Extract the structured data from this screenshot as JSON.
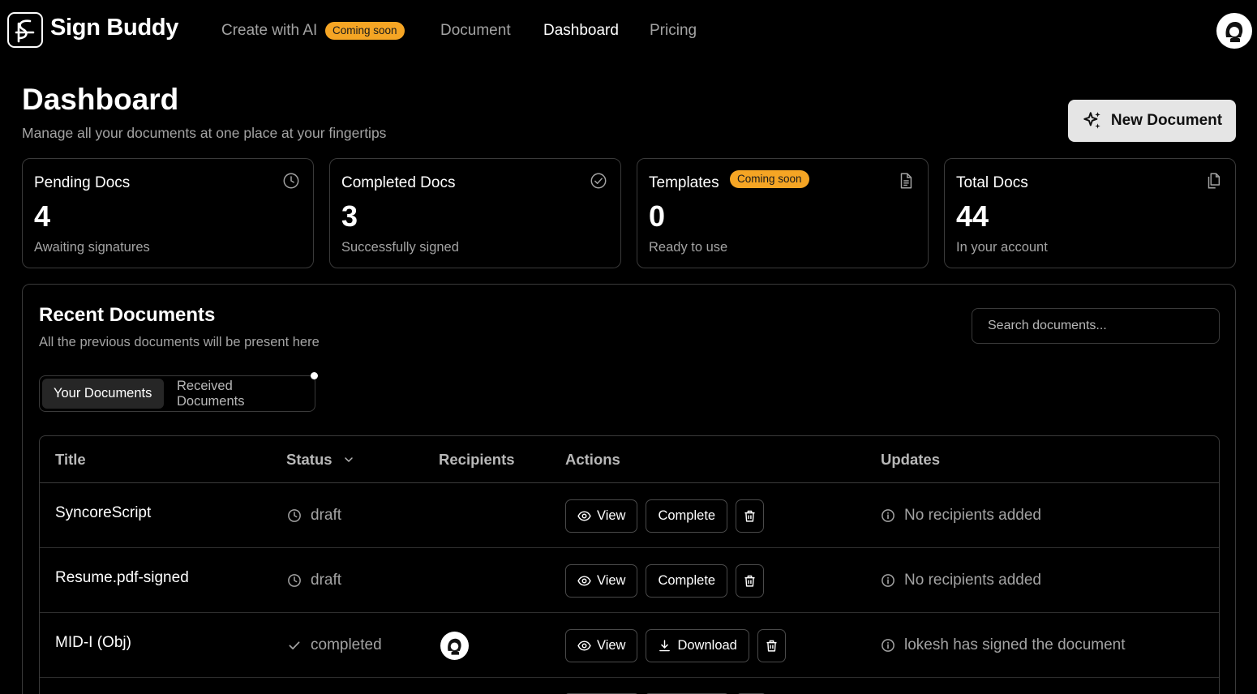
{
  "nav": {
    "brand": "Sign Buddy",
    "links": [
      {
        "label": "Create with AI",
        "badge": "Coming soon"
      },
      {
        "label": "Document"
      },
      {
        "label": "Dashboard",
        "active": true
      },
      {
        "label": "Pricing"
      }
    ]
  },
  "header": {
    "title": "Dashboard",
    "subtitle": "Manage all your documents at one place at your fingertips",
    "new_button": "New Document"
  },
  "stats": [
    {
      "title": "Pending Docs",
      "value": "4",
      "sub": "Awaiting signatures",
      "icon": "clock-icon"
    },
    {
      "title": "Completed Docs",
      "value": "3",
      "sub": "Successfully signed",
      "icon": "check-circle-icon"
    },
    {
      "title": "Templates",
      "badge": "Coming soon",
      "value": "0",
      "sub": "Ready to use",
      "icon": "file-text-icon"
    },
    {
      "title": "Total Docs",
      "value": "44",
      "sub": "In your account",
      "icon": "files-icon"
    }
  ],
  "recent": {
    "title": "Recent Documents",
    "subtitle": "All the previous documents will be present here",
    "search_placeholder": "Search documents...",
    "tabs": [
      "Your Documents",
      "Received Documents"
    ],
    "columns": [
      "Title",
      "Status",
      "Recipients",
      "Actions",
      "Updates"
    ],
    "rows": [
      {
        "title": "SyncoreScript",
        "status": "draft",
        "actions": [
          "View",
          "Complete"
        ],
        "update": "No recipients added"
      },
      {
        "title": "Resume.pdf-signed",
        "status": "draft",
        "actions": [
          "View",
          "Complete"
        ],
        "update": "No recipients added"
      },
      {
        "title": "MID-I (Obj)",
        "status": "completed",
        "actions": [
          "View",
          "Download"
        ],
        "update": "lokesh has signed the document"
      }
    ]
  },
  "colors": {
    "accent": "#f5a524",
    "background": "#000000",
    "muted": "#a3a3a3",
    "border": "#3a3a3a"
  }
}
